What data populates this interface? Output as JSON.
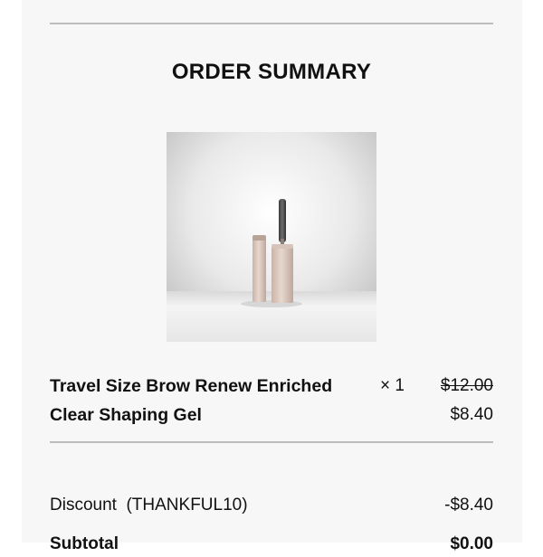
{
  "order_summary": {
    "title": "ORDER SUMMARY",
    "item": {
      "name": "Travel Size Brow Renew Enriched Clear Shaping Gel",
      "quantity": "× 1",
      "original_price": "$12.00",
      "price": "$8.40",
      "image_icon": "product-photo"
    },
    "discount": {
      "label": "Discount  (THANKFUL10)",
      "value": "-$8.40"
    },
    "subtotal": {
      "label": "Subtotal",
      "value": "$0.00"
    }
  },
  "colors": {
    "panel_background": "#f7f7f7",
    "divider": "#bdbdbd",
    "text": "#111111"
  }
}
